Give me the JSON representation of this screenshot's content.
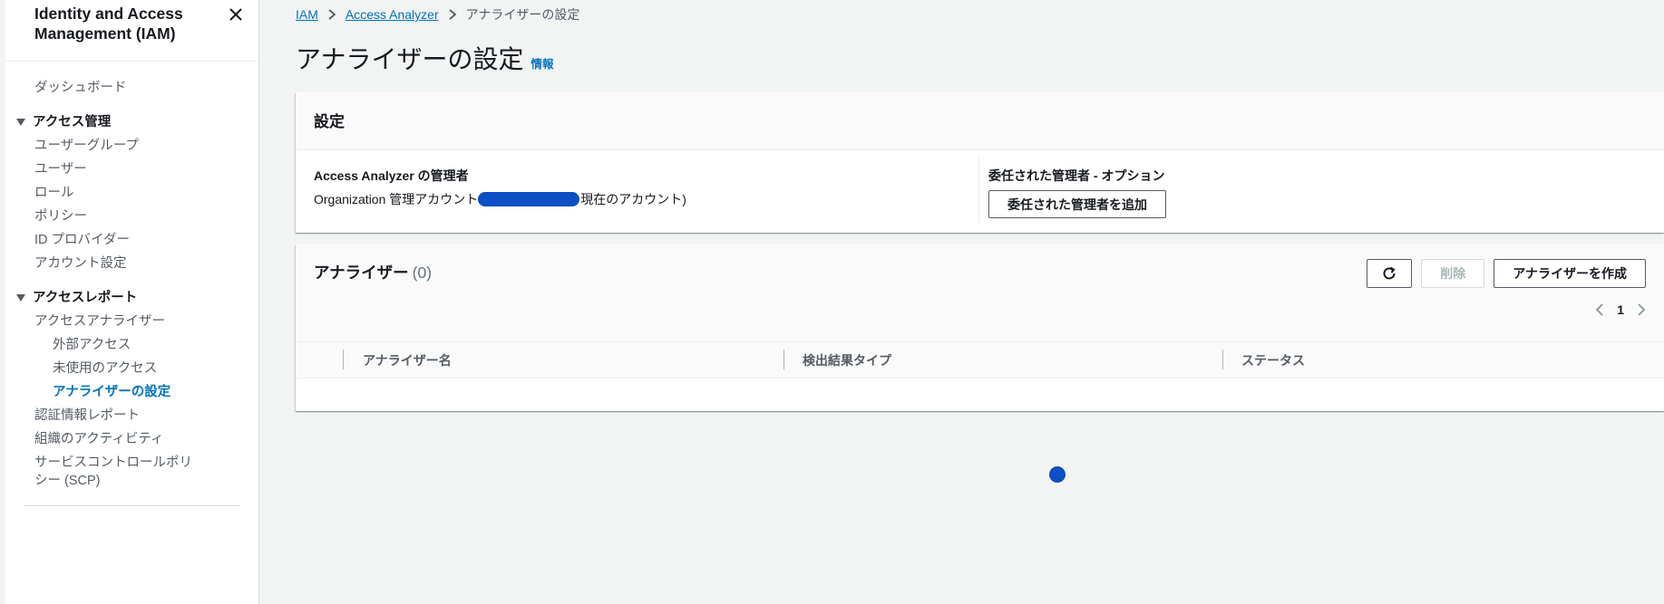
{
  "sidebar": {
    "title": "Identity and Access Management (IAM)",
    "close_icon": "close-icon",
    "dashboard": "ダッシュボード",
    "section_access_management": "アクセス管理",
    "items_access_management": [
      "ユーザーグループ",
      "ユーザー",
      "ロール",
      "ポリシー",
      "ID プロバイダー",
      "アカウント設定"
    ],
    "section_access_reports": "アクセスレポート",
    "access_analyzer": "アクセスアナライザー",
    "access_analyzer_subitems": [
      "外部アクセス",
      "未使用のアクセス",
      "アナライザーの設定"
    ],
    "report_items": [
      "認証情報レポート",
      "組織のアクティビティ",
      "サービスコントロールポリシー (SCP)"
    ]
  },
  "breadcrumb": {
    "iam": "IAM",
    "access_analyzer": "Access Analyzer",
    "current": "アナライザーの設定"
  },
  "page": {
    "title": "アナライザーの設定",
    "info": "情報"
  },
  "settings": {
    "header": "設定",
    "admin_label": "Access Analyzer の管理者",
    "admin_value_prefix": "Organization 管理アカウント",
    "admin_value_suffix": "現在のアカウント)",
    "delegated_label": "委任された管理者 - オプション",
    "add_delegated_button": "委任された管理者を追加"
  },
  "analyzers": {
    "title": "アナライザー",
    "count": "(0)",
    "delete_button": "削除",
    "create_button": "アナライザーを作成",
    "page_number": "1",
    "columns": [
      "アナライザー名",
      "検出結果タイプ",
      "ステータス"
    ]
  },
  "colors": {
    "link": "#0073bb",
    "redaction": "#0d4fc4",
    "background": "#f2f3f3"
  }
}
